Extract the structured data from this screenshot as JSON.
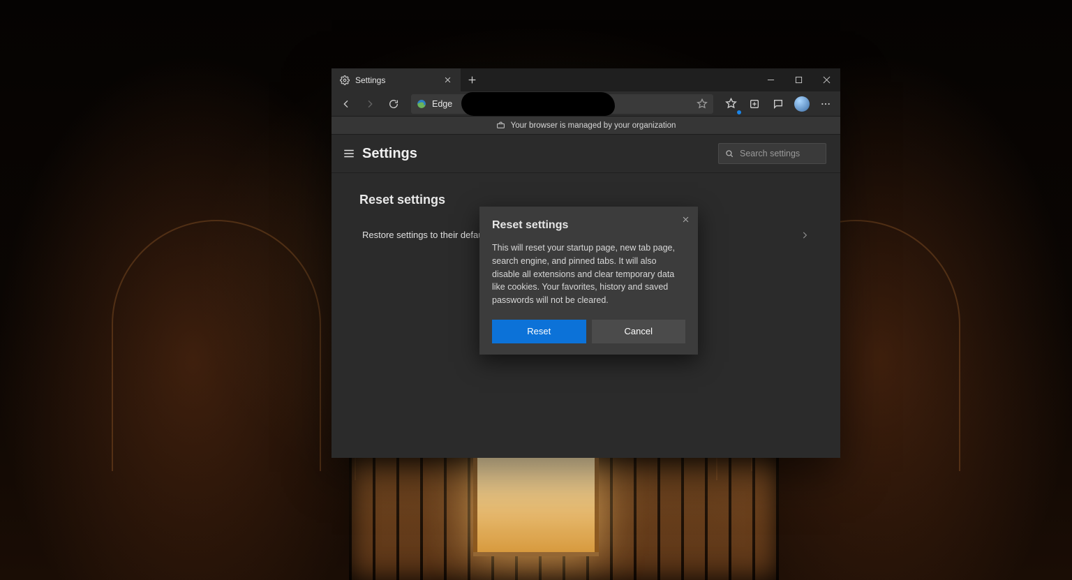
{
  "tab": {
    "title": "Settings"
  },
  "address_bar": {
    "label": "Edge"
  },
  "managed_banner": {
    "text": "Your browser is managed by your organization"
  },
  "settings_header": {
    "title": "Settings",
    "search_placeholder": "Search settings"
  },
  "section": {
    "title": "Reset settings",
    "row_label": "Restore settings to their default val"
  },
  "dialog": {
    "title": "Reset settings",
    "body": "This will reset your startup page, new tab page, search engine, and pinned tabs. It will also disable all extensions and clear temporary data like cookies. Your favorites, history and saved passwords will not be cleared.",
    "primary": "Reset",
    "secondary": "Cancel"
  },
  "colors": {
    "accent": "#0c72d8"
  }
}
